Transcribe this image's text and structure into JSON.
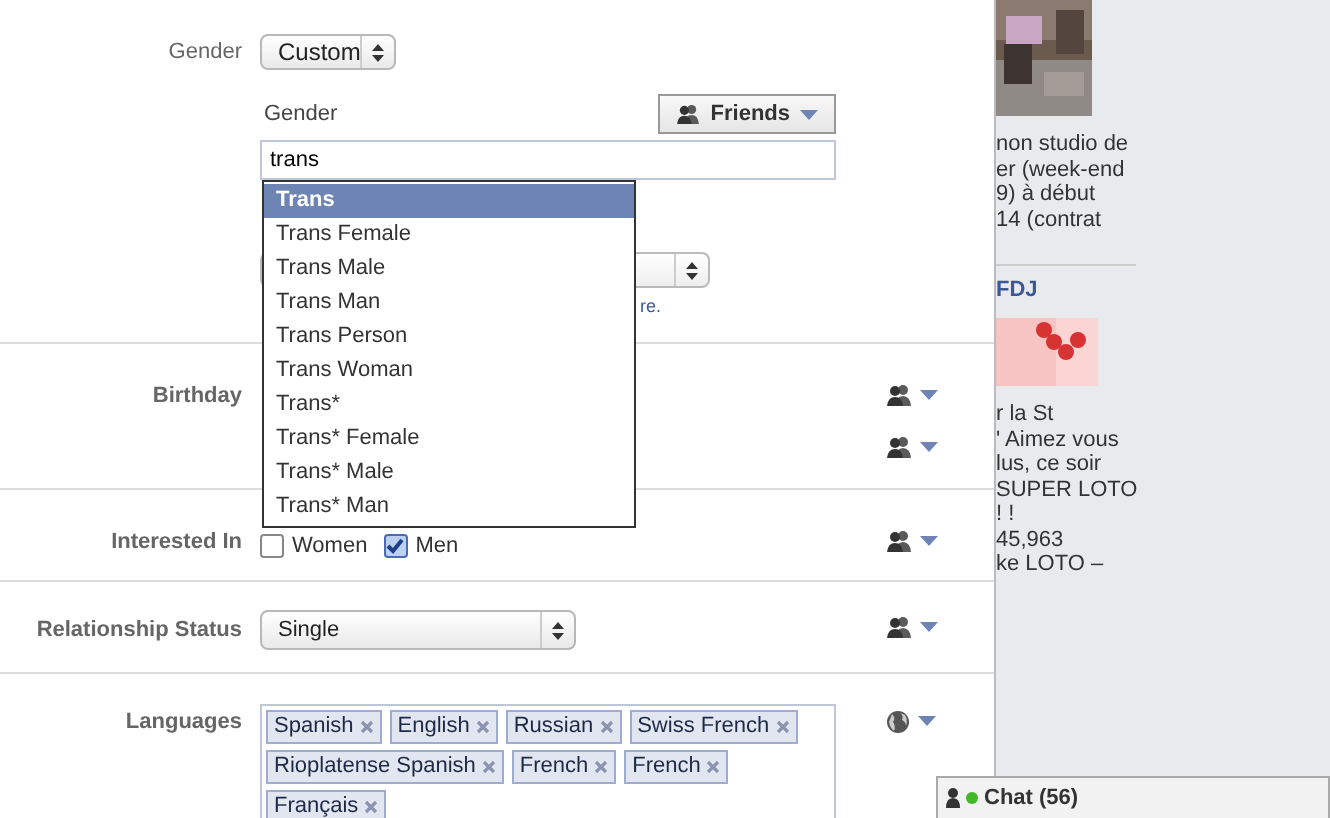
{
  "gender": {
    "label": "Gender",
    "select": "Custom",
    "custom_label": "Gender",
    "audience": "Friends",
    "input_value": "trans",
    "suggestions": [
      {
        "label": "Trans",
        "selected": true
      },
      {
        "label": "Trans Female",
        "selected": false
      },
      {
        "label": "Trans Male",
        "selected": false
      },
      {
        "label": "Trans Man",
        "selected": false
      },
      {
        "label": "Trans Person",
        "selected": false
      },
      {
        "label": "Trans Woman",
        "selected": false
      },
      {
        "label": "Trans*",
        "selected": false
      },
      {
        "label": "Trans* Female",
        "selected": false
      },
      {
        "label": "Trans* Male",
        "selected": false
      },
      {
        "label": "Trans* Man",
        "selected": false
      }
    ],
    "link": "re."
  },
  "birthday": {
    "label": "Birthday",
    "audience_controls": [
      {
        "kind": "friends"
      },
      {
        "kind": "friends"
      }
    ]
  },
  "interested_in": {
    "label": "Interested In",
    "options": [
      {
        "label": "Women",
        "checked": false
      },
      {
        "label": "Men",
        "checked": true
      }
    ],
    "audience": {
      "kind": "friends"
    }
  },
  "relationship_status": {
    "label": "Relationship Status",
    "value": "Single",
    "audience": {
      "kind": "friends"
    }
  },
  "languages": {
    "label": "Languages",
    "tokens": [
      "Spanish",
      "English",
      "Russian",
      "Swiss French",
      "Rioplatense Spanish",
      "French",
      "French",
      "Français"
    ],
    "audience": {
      "kind": "public"
    }
  },
  "sidebar": {
    "story_lines": [
      "non studio de",
      "er (week-end",
      "9) à début",
      "14 (contrat"
    ],
    "page_name": "FDJ",
    "ad_lines": [
      "r la St",
      "' Aimez vous",
      "lus, ce soir",
      "SUPER LOTO",
      "! !",
      "45,963",
      "ke LOTO –"
    ]
  },
  "chat": {
    "label": "Chat (56)",
    "online": true
  }
}
